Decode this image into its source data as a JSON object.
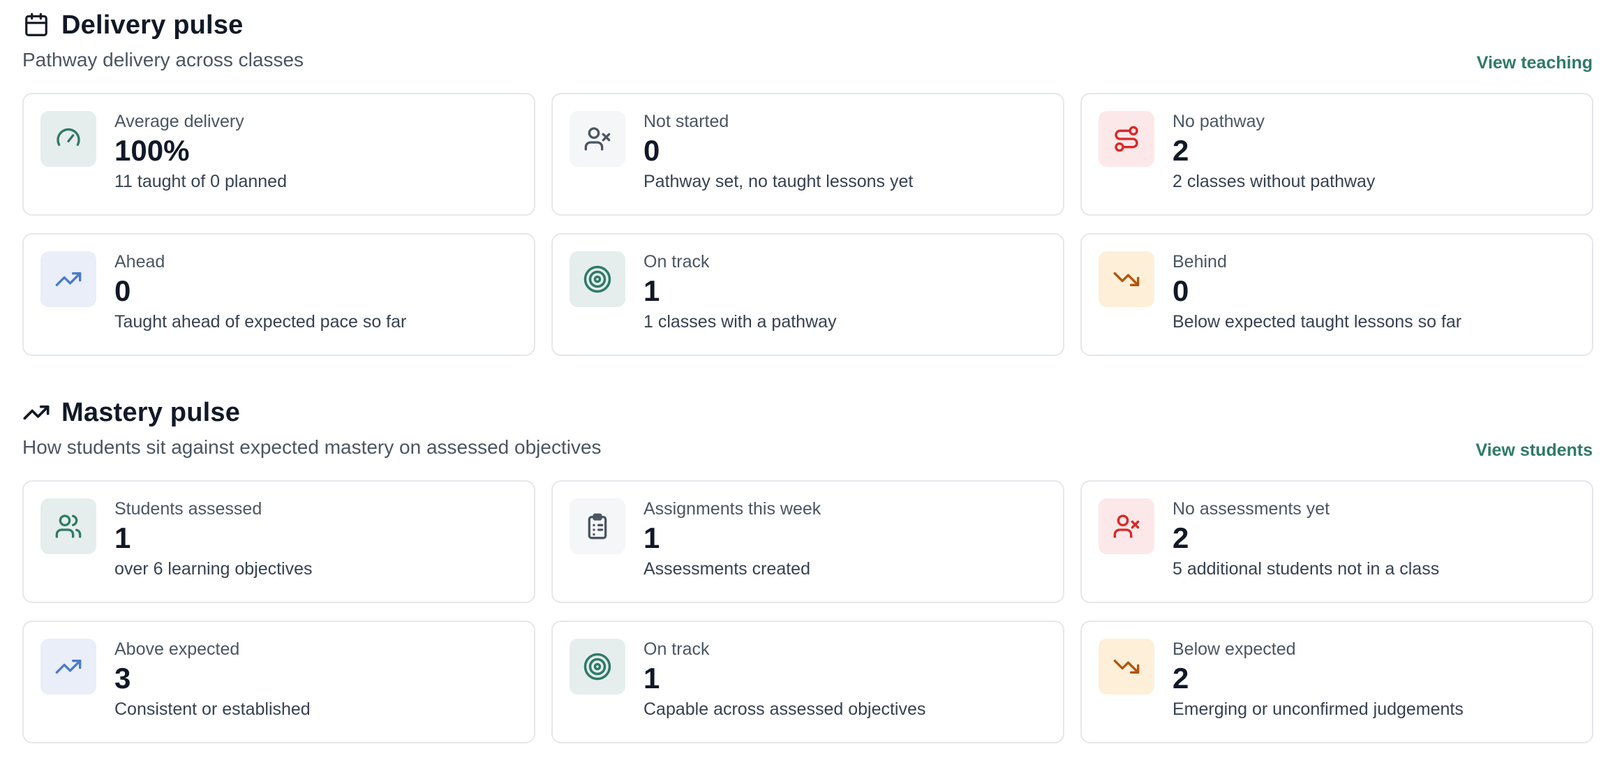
{
  "colors": {
    "accent_green": "#2f7a68",
    "red": "#dc2626",
    "blue": "#4a7ac8",
    "amber": "#b45309",
    "gray_icon": "#4b5563"
  },
  "delivery": {
    "icon": "calendar-icon",
    "title": "Delivery pulse",
    "subtitle": "Pathway delivery across classes",
    "link": "View teaching",
    "cards": [
      {
        "icon": "speedometer-icon",
        "label": "Average delivery",
        "value": "100%",
        "desc": "11 taught of 0 planned"
      },
      {
        "icon": "user-x-icon",
        "label": "Not started",
        "value": "0",
        "desc": "Pathway set, no taught lessons yet"
      },
      {
        "icon": "route-icon",
        "label": "No pathway",
        "value": "2",
        "desc": "2 classes without pathway"
      },
      {
        "icon": "trending-up-icon",
        "label": "Ahead",
        "value": "0",
        "desc": "Taught ahead of expected pace so far"
      },
      {
        "icon": "target-icon",
        "label": "On track",
        "value": "1",
        "desc": "1 classes with a pathway"
      },
      {
        "icon": "trending-down-icon",
        "label": "Behind",
        "value": "0",
        "desc": "Below expected taught lessons so far"
      }
    ]
  },
  "mastery": {
    "icon": "trending-up-icon",
    "title": "Mastery pulse",
    "subtitle": "How students sit against expected mastery on assessed objectives",
    "link": "View students",
    "cards": [
      {
        "icon": "users-icon",
        "label": "Students assessed",
        "value": "1",
        "desc": "over 6 learning objectives"
      },
      {
        "icon": "clipboard-list-icon",
        "label": "Assignments this week",
        "value": "1",
        "desc": "Assessments created"
      },
      {
        "icon": "user-x-icon",
        "label": "No assessments yet",
        "value": "2",
        "desc": "5 additional students not in a class"
      },
      {
        "icon": "trending-up-icon",
        "label": "Above expected",
        "value": "3",
        "desc": "Consistent or established"
      },
      {
        "icon": "target-icon",
        "label": "On track",
        "value": "1",
        "desc": "Capable across assessed objectives"
      },
      {
        "icon": "trending-down-icon",
        "label": "Below expected",
        "value": "2",
        "desc": "Emerging or unconfirmed judgements"
      }
    ]
  }
}
